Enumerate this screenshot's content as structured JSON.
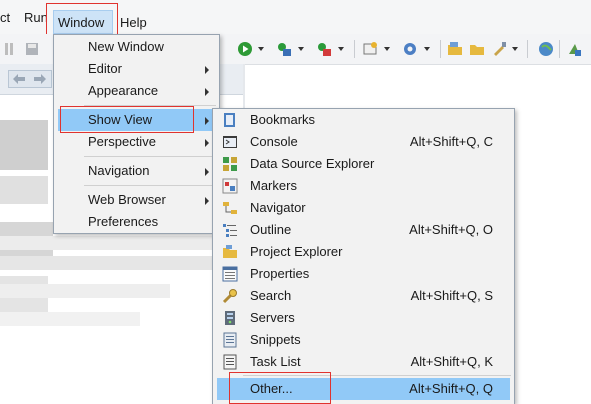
{
  "menubar": {
    "items": [
      {
        "label": "ct"
      },
      {
        "label": "Run"
      },
      {
        "label": "Window"
      },
      {
        "label": "Help"
      }
    ]
  },
  "window_menu": {
    "items": [
      {
        "label": "New Window"
      },
      {
        "label": "Editor"
      },
      {
        "label": "Appearance"
      },
      {
        "label": "Show View"
      },
      {
        "label": "Perspective"
      },
      {
        "label": "Navigation"
      },
      {
        "label": "Web Browser"
      },
      {
        "label": "Preferences"
      }
    ]
  },
  "show_view_menu": {
    "items": [
      {
        "label": "Bookmarks",
        "shortcut": "",
        "icon": "bookmarks-icon"
      },
      {
        "label": "Console",
        "shortcut": "Alt+Shift+Q, C",
        "icon": "console-icon"
      },
      {
        "label": "Data Source Explorer",
        "shortcut": "",
        "icon": "data-source-icon"
      },
      {
        "label": "Markers",
        "shortcut": "",
        "icon": "markers-icon"
      },
      {
        "label": "Navigator",
        "shortcut": "",
        "icon": "navigator-icon"
      },
      {
        "label": "Outline",
        "shortcut": "Alt+Shift+Q, O",
        "icon": "outline-icon"
      },
      {
        "label": "Project Explorer",
        "shortcut": "",
        "icon": "project-explorer-icon"
      },
      {
        "label": "Properties",
        "shortcut": "",
        "icon": "properties-icon"
      },
      {
        "label": "Search",
        "shortcut": "Alt+Shift+Q, S",
        "icon": "search-icon"
      },
      {
        "label": "Servers",
        "shortcut": "",
        "icon": "servers-icon"
      },
      {
        "label": "Snippets",
        "shortcut": "",
        "icon": "snippets-icon"
      },
      {
        "label": "Task List",
        "shortcut": "Alt+Shift+Q, K",
        "icon": "task-list-icon"
      },
      {
        "label": "Other...",
        "shortcut": "Alt+Shift+Q, Q",
        "icon": ""
      }
    ]
  },
  "colors": {
    "highlight": "#91c9f7",
    "annotation_box": "#e0332f",
    "menu_bg": "#f2f2f2"
  }
}
